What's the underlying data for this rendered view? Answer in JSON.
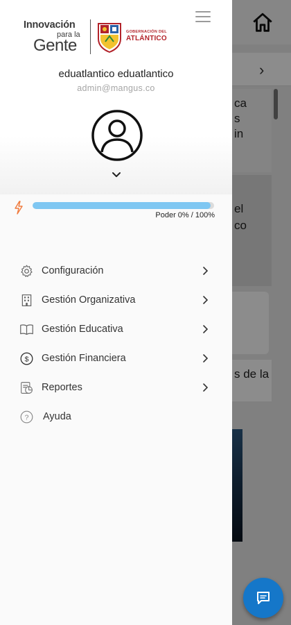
{
  "background": {
    "tab_chevron": "›",
    "fragments": [
      "ca",
      "s",
      "in",
      "el",
      "co",
      "s de la"
    ]
  },
  "drawer": {
    "logo": {
      "line1": "Innovación",
      "line2": "para la",
      "line3": "Gente",
      "gob_line1": "GOBERNACIÓN DEL",
      "gob_line2": "ATLÁNTICO"
    },
    "user": {
      "name": "eduatlantico eduatlantico",
      "email": "admin@mangus.co"
    },
    "power": {
      "label": "Poder 0% / 100%",
      "value_fraction": 0.98
    },
    "menu": [
      {
        "label": "Configuración",
        "icon": "gear-icon",
        "has_chevron": true
      },
      {
        "label": "Gestión Organizativa",
        "icon": "building-icon",
        "has_chevron": true
      },
      {
        "label": "Gestión Educativa",
        "icon": "book-icon",
        "has_chevron": true
      },
      {
        "label": "Gestión Financiera",
        "icon": "dollar-circle-icon",
        "has_chevron": true
      },
      {
        "label": "Reportes",
        "icon": "report-icon",
        "has_chevron": true
      },
      {
        "label": "Ayuda",
        "icon": "help-circle-icon",
        "has_chevron": false
      }
    ]
  },
  "colors": {
    "accent_blue": "#1577c9",
    "progress_blue": "#7fc7f2",
    "power_orange": "#f07a3c",
    "brand_red": "#b2232a"
  }
}
